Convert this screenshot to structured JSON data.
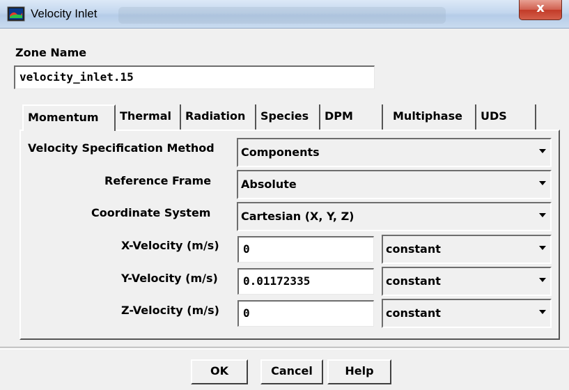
{
  "window": {
    "title": "Velocity Inlet",
    "close_label": "x"
  },
  "zone": {
    "label": "Zone Name",
    "value": "velocity_inlet.15"
  },
  "tabs": [
    {
      "label": "Momentum"
    },
    {
      "label": "Thermal"
    },
    {
      "label": "Radiation"
    },
    {
      "label": "Species"
    },
    {
      "label": "DPM"
    },
    {
      "label": "Multiphase"
    },
    {
      "label": "UDS"
    }
  ],
  "selected_tab": "Momentum",
  "form": {
    "velocity_spec_method": {
      "label": "Velocity Specification Method",
      "value": "Components"
    },
    "reference_frame": {
      "label": "Reference Frame",
      "value": "Absolute"
    },
    "coordinate_system": {
      "label": "Coordinate System",
      "value": "Cartesian (X, Y, Z)"
    },
    "x_velocity": {
      "label": "X-Velocity (m/s)",
      "value": "0",
      "profile": "constant"
    },
    "y_velocity": {
      "label": "Y-Velocity (m/s)",
      "value": "0.01172335",
      "profile": "constant"
    },
    "z_velocity": {
      "label": "Z-Velocity (m/s)",
      "value": "0",
      "profile": "constant"
    }
  },
  "buttons": {
    "ok": "OK",
    "cancel": "Cancel",
    "help": "Help"
  },
  "colors": {
    "close_button": "#c23b28",
    "background": "#f0f0f0"
  },
  "icons": {
    "app": "fluent-app-icon",
    "close": "close-icon",
    "dropdown": "chevron-down-icon"
  }
}
